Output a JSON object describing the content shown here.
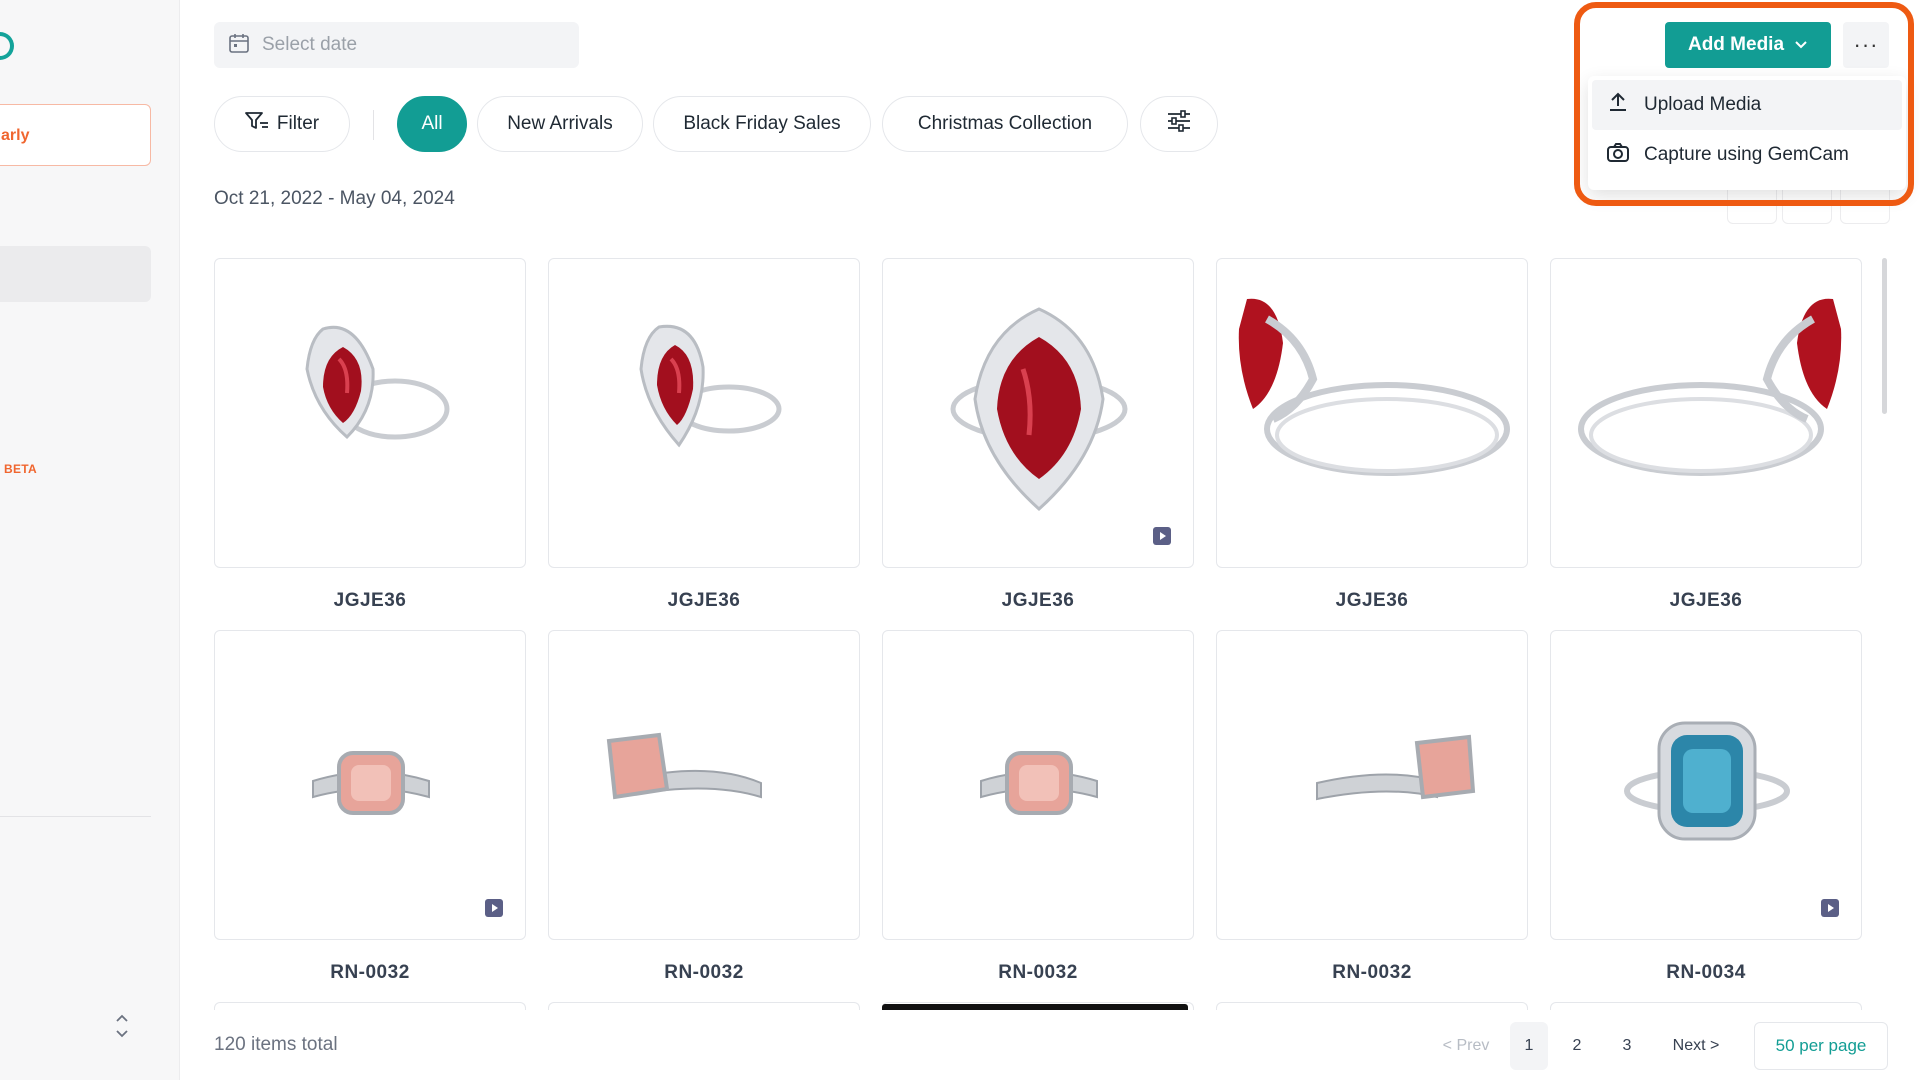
{
  "sidebar": {
    "early_label": "arly",
    "beta_label": "BETA"
  },
  "toolbar": {
    "date_placeholder": "Select date",
    "add_media_label": "Add Media",
    "more_label": "···"
  },
  "dropdown": {
    "items": [
      {
        "label": "Upload Media",
        "icon": "upload-icon"
      },
      {
        "label": "Capture using GemCam",
        "icon": "camera-icon"
      }
    ]
  },
  "filters": {
    "filter_label": "Filter",
    "chips": [
      "All",
      "New Arrivals",
      "Black Friday Sales",
      "Christmas Collection"
    ],
    "active_chip": "All"
  },
  "date_range": "Oct 21, 2022 - May 04, 2024",
  "media": [
    {
      "sku": "JGJE36",
      "image": "ruby-pear-halo-ring-front",
      "video": false
    },
    {
      "sku": "JGJE36",
      "image": "ruby-pear-halo-ring-angle",
      "video": false
    },
    {
      "sku": "JGJE36",
      "image": "ruby-pear-halo-ring-closeup",
      "video": true
    },
    {
      "sku": "JGJE36",
      "image": "ruby-ring-side-view",
      "video": false
    },
    {
      "sku": "JGJE36",
      "image": "ruby-ring-side-view-reverse",
      "video": false
    },
    {
      "sku": "RN-0032",
      "image": "pink-cushion-ring-front",
      "video": true
    },
    {
      "sku": "RN-0032",
      "image": "pink-cushion-ring-angle",
      "video": false
    },
    {
      "sku": "RN-0032",
      "image": "pink-cushion-ring-front",
      "video": false
    },
    {
      "sku": "RN-0032",
      "image": "pink-cushion-ring-side",
      "video": false
    },
    {
      "sku": "RN-0034",
      "image": "blue-radiant-halo-ring",
      "video": true
    }
  ],
  "footer": {
    "total_label": "120 items total",
    "prev_label": "< Prev",
    "pages": [
      "1",
      "2",
      "3"
    ],
    "current_page": "1",
    "next_label": "Next >",
    "per_page_label": "50 per page"
  },
  "colors": {
    "accent": "#129d94",
    "highlight": "#ee5a12",
    "brand_orange": "#f0662f"
  }
}
